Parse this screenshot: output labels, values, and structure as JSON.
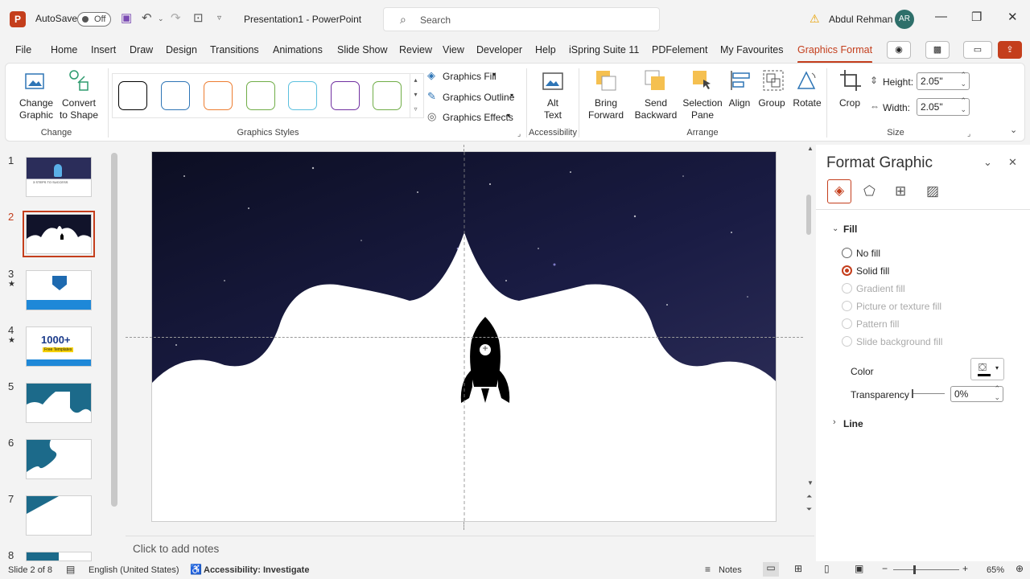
{
  "titlebar": {
    "logo": "P",
    "autosave_label": "AutoSave",
    "autosave_state": "Off",
    "doc_title": "Presentation1  -  PowerPoint",
    "search_placeholder": "Search",
    "user_name": "Abdul Rehman",
    "user_initials": "AR"
  },
  "tabs": [
    "File",
    "Home",
    "Insert",
    "Draw",
    "Design",
    "Transitions",
    "Animations",
    "Slide Show",
    "Review",
    "View",
    "Developer",
    "Help",
    "iSpring Suite 11",
    "PDFelement",
    "My Favourites",
    "Graphics Format"
  ],
  "active_tab": "Graphics Format",
  "ribbon": {
    "change_graphic": "Change Graphic",
    "convert_to_shape": "Convert to Shape",
    "group_change": "Change",
    "graphics_fill": "Graphics Fill",
    "graphics_outline": "Graphics Outline",
    "graphics_effects": "Graphics Effects",
    "group_styles": "Graphics Styles",
    "alt_text": "Alt Text",
    "group_accessibility": "Accessibility",
    "bring_forward": "Bring Forward",
    "send_backward": "Send Backward",
    "selection_pane": "Selection Pane",
    "align": "Align",
    "group": "Group",
    "rotate": "Rotate",
    "group_arrange": "Arrange",
    "crop": "Crop",
    "height_label": "Height:",
    "height_value": "2.05\"",
    "width_label": "Width:",
    "width_value": "2.05\"",
    "group_size": "Size",
    "style_colors": [
      "#000000",
      "#2e75b6",
      "#ed7d31",
      "#70ad47",
      "#5bc0de",
      "#7030a0",
      "#70ad47"
    ]
  },
  "slides": [
    "1",
    "2",
    "3",
    "4",
    "5",
    "6",
    "7",
    "8"
  ],
  "slide_thumbs": [
    {
      "top_text": "3 STEPS TO SUCCESS"
    },
    {
      "top_text": ""
    },
    {
      "top_text": ""
    },
    {
      "top_text": "1000+",
      "sub_text": "Free Templates"
    },
    {
      "top_text": ""
    },
    {
      "top_text": ""
    },
    {
      "top_text": ""
    },
    {
      "top_text": ""
    }
  ],
  "notes_placeholder": "Click to add notes",
  "format_pane": {
    "title": "Format Graphic",
    "section_fill": "Fill",
    "options": [
      {
        "label": "No fill",
        "state": "off"
      },
      {
        "label": "Solid fill",
        "state": "on"
      },
      {
        "label": "Gradient fill",
        "state": "disabled"
      },
      {
        "label": "Picture or texture fill",
        "state": "disabled"
      },
      {
        "label": "Pattern fill",
        "state": "disabled"
      },
      {
        "label": "Slide background fill",
        "state": "disabled"
      }
    ],
    "color_label": "Color",
    "transparency_label": "Transparency",
    "transparency_value": "0%",
    "section_line": "Line"
  },
  "status": {
    "slide_info": "Slide 2 of 8",
    "language": "English (United States)",
    "accessibility": "Accessibility: Investigate",
    "notes_btn": "Notes",
    "zoom": "65%"
  }
}
